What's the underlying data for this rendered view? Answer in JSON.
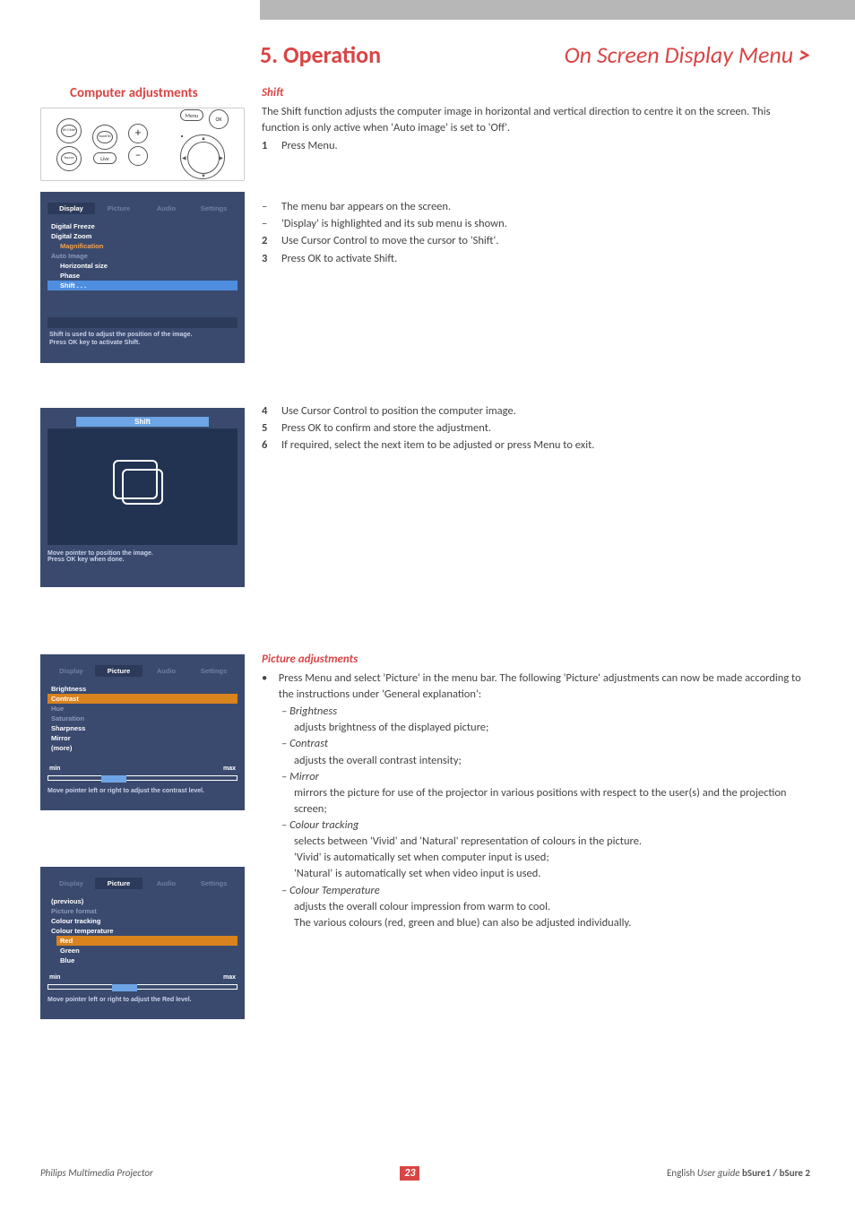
{
  "header": {
    "left": "5. Operation",
    "right": "On Screen Display Menu",
    "chevron": ">"
  },
  "sidebar_title": "Computer adjustments",
  "remote": {
    "b1": "AV Mute",
    "b2": "Stand by",
    "b3": "Source",
    "b4": "Live",
    "plus": "+",
    "minus": "–",
    "menu": "Menu",
    "ok": "OK"
  },
  "osd1": {
    "tabs": [
      "Display",
      "Picture",
      "Audio",
      "Settings"
    ],
    "active_tab": 0,
    "items": [
      {
        "label": "Digital Freeze",
        "cls": ""
      },
      {
        "label": "Digital Zoom",
        "cls": ""
      },
      {
        "label": "Magnification",
        "cls": "sub orange"
      },
      {
        "label": "Auto Image",
        "cls": "grey"
      },
      {
        "label": "Horizontal size",
        "cls": "sub"
      },
      {
        "label": "Phase",
        "cls": "sub"
      },
      {
        "label": "Shift . . .",
        "cls": "sel"
      }
    ],
    "help": [
      "Shift is used to adjust the position of the image.",
      "Press OK key to activate Shift."
    ]
  },
  "osd_shift": {
    "title": "Shift",
    "help": [
      "Move pointer to position the image.",
      "Press OK key when done."
    ]
  },
  "osd2": {
    "tabs": [
      "Display",
      "Picture",
      "Audio",
      "Settings"
    ],
    "active_tab": 1,
    "items": [
      {
        "label": "Brightness",
        "cls": ""
      },
      {
        "label": "Contrast",
        "cls": "orange-sel"
      },
      {
        "label": "Hue",
        "cls": "grey"
      },
      {
        "label": "Saturation",
        "cls": "grey"
      },
      {
        "label": "Sharpness",
        "cls": ""
      },
      {
        "label": "Mirror",
        "cls": ""
      },
      {
        "label": "(more)",
        "cls": ""
      }
    ],
    "slider": {
      "min": "min",
      "max": "max",
      "pos_pct": 28
    },
    "help": "Move pointer left or right to adjust the contrast level."
  },
  "osd3": {
    "tabs": [
      "Display",
      "Picture",
      "Audio",
      "Settings"
    ],
    "active_tab": 1,
    "items": [
      {
        "label": "(previous)",
        "cls": ""
      },
      {
        "label": "Picture format",
        "cls": "grey"
      },
      {
        "label": "Colour tracking",
        "cls": ""
      },
      {
        "label": "Colour temperature",
        "cls": ""
      },
      {
        "label": "Red",
        "cls": "sub orange-sel"
      },
      {
        "label": "Green",
        "cls": "sub"
      },
      {
        "label": "Blue",
        "cls": "sub"
      }
    ],
    "slider": {
      "min": "min",
      "max": "max",
      "pos_pct": 34
    },
    "help": "Move pointer left or right to adjust the Red level."
  },
  "shift_section": {
    "title": "Shift",
    "intro": "The Shift function adjusts the computer image in horizontal and vertical direction to centre it on the screen. This function is only active when 'Auto image' is set to 'Off'.",
    "s1": "Press Menu.",
    "d1": "The menu bar appears on the screen.",
    "d2": "'Display' is highlighted and its sub menu is shown.",
    "s2": "Use Cursor Control to move the cursor to 'Shift'.",
    "s3": "Press OK to activate Shift.",
    "s4": "Use Cursor Control to position the computer image.",
    "s5": "Press OK to confirm and store the adjustment.",
    "s6": "If required, select the next item to be adjusted or press Menu to exit."
  },
  "picture_section": {
    "title": "Picture adjustments",
    "intro": "Press Menu and select 'Picture' in the menu bar.  The following 'Picture' adjustments can now be made according to the instructions under 'General explanation':",
    "items": [
      {
        "name": "Brightness",
        "desc": "adjusts brightness of the displayed picture;"
      },
      {
        "name": "Contrast",
        "desc": "adjusts the overall contrast intensity;"
      },
      {
        "name": "Mirror",
        "desc": "mirrors the picture for use of the projector in various positions with respect to the user(s) and the projection screen;"
      },
      {
        "name": "Colour tracking",
        "lines": [
          "selects between 'Vivid' and 'Natural' representation of colours in the picture.",
          "'Vivid' is automatically set when computer input is used;",
          "'Natural' is automatically set when video input is used."
        ]
      },
      {
        "name": "Colour Temperature",
        "lines": [
          "adjusts the overall colour impression from warm to cool.",
          "The various colours (red, green and blue) can also be adjusted individually."
        ]
      }
    ]
  },
  "footer": {
    "left_italic": "Philips Multimedia Projector",
    "page": "23",
    "right_plain": "English ",
    "right_italic": "User guide  ",
    "right_bold": "bSure1 / bSure 2"
  },
  "n": {
    "1": "1",
    "2": "2",
    "3": "3",
    "4": "4",
    "5": "5",
    "6": "6",
    "dash": "–",
    "bull": "•"
  }
}
